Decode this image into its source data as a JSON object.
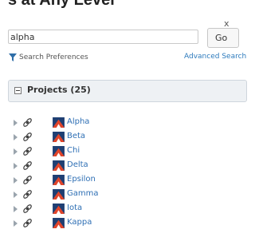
{
  "header": {
    "title": "s at Any Level"
  },
  "dialog": {
    "close_glyph": "x"
  },
  "search": {
    "value": "alpha",
    "go_label": "Go",
    "preferences_label": "Search Preferences",
    "advanced_label": "Advanced Search"
  },
  "projects_panel": {
    "title": "Projects (25)",
    "items": [
      {
        "name": "Alpha"
      },
      {
        "name": "Beta"
      },
      {
        "name": "Chi"
      },
      {
        "name": "Delta"
      },
      {
        "name": "Epsilon"
      },
      {
        "name": "Gamma"
      },
      {
        "name": "Iota"
      },
      {
        "name": "Kappa"
      }
    ]
  },
  "icons": {
    "funnel": "filter-funnel-icon",
    "link": "link-chain-icon",
    "project": "project-icon",
    "expander": "expand-triangle-icon",
    "collapse": "collapse-minus-icon"
  },
  "colors": {
    "link": "#2e6fb4",
    "advanced_link": "#2e7bbd",
    "panel_bg": "#eef1f4",
    "project_icon_blue": "#1f3f73",
    "project_icon_red": "#e0452b"
  }
}
